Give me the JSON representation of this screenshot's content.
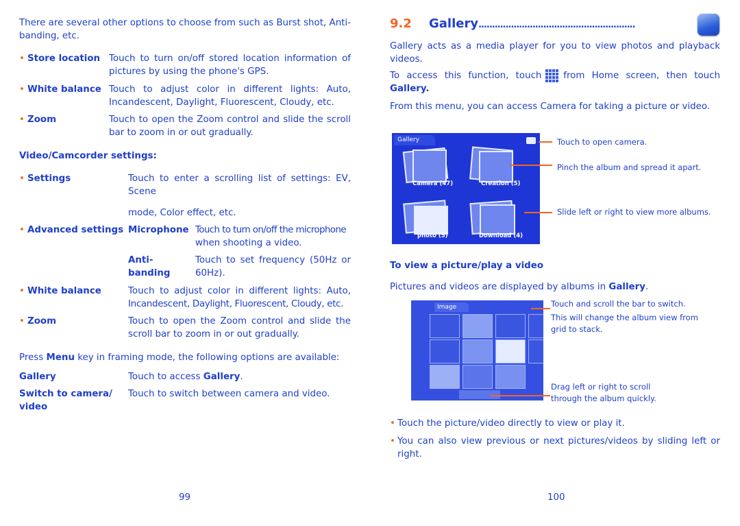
{
  "left_page": {
    "intro": [
      "There are several other options to choose from such as Burst shot, Anti-",
      "banding, etc."
    ],
    "photo_settings": [
      {
        "term": "Store location",
        "desc": [
          "Touch to turn on/off stored location information of",
          "pictures by using the phone's GPS."
        ]
      },
      {
        "term": "White balance",
        "desc": [
          "Touch to adjust color in different lights: Auto,",
          "Incandescent, Daylight, Fluorescent, Cloudy, etc."
        ]
      },
      {
        "term": "Zoom",
        "desc": [
          "Touch to open the Zoom control and slide the scroll",
          "bar to zoom in or out gradually."
        ]
      }
    ],
    "video_heading": "Video/Camcorder settings:",
    "settings": {
      "term": "Settings",
      "desc": [
        "Touch to enter a scrolling list of settings: EV,",
        "Scene",
        "mode, Color effect, etc."
      ]
    },
    "advanced": {
      "term": "Advanced settings",
      "items": [
        {
          "term": "Microphone",
          "desc": [
            "Touch to turn on/off the microphone",
            "when shooting a video."
          ]
        },
        {
          "term": [
            "Anti-",
            "banding"
          ],
          "desc": [
            "Touch to set frequency (50Hz or",
            "60Hz)."
          ]
        }
      ]
    },
    "video_settings": [
      {
        "term": "White balance",
        "desc": [
          "Touch to adjust color in different lights: Auto,",
          "Incandescent, Daylight, Fluorescent, Cloudy, etc."
        ]
      },
      {
        "term": "Zoom",
        "desc": [
          "Touch to open the Zoom control and slide the",
          "scroll bar to zoom in or out gradually."
        ]
      }
    ],
    "menu_note": {
      "pre": "Press ",
      "key": "Menu",
      "post": " key in framing mode, the following options are available:"
    },
    "menu_options": [
      {
        "term": "Gallery",
        "desc_pre": "Touch to access ",
        "desc_bold": "Gallery",
        "desc_post": "."
      },
      {
        "term": [
          "Switch to camera/",
          "video"
        ],
        "desc": "Touch to switch between camera and video."
      }
    ],
    "page_number": "99"
  },
  "right_page": {
    "section_number": "9.2",
    "section_title": "Gallery",
    "section_icon": "gallery-app-icon",
    "para1": [
      "Gallery acts as a media player for you to view photos and playback",
      "videos."
    ],
    "para2": {
      "pre": "To access this function, touch",
      "icon": "app-grid-icon",
      "post": "from Home screen, then touch",
      "bold": "Gallery."
    },
    "para3": "From this menu, you can access Camera for taking a picture or video.",
    "screenshot1": {
      "header": "Gallery",
      "albums": [
        "Camera (47)",
        "Creation (5)",
        "photo (5)",
        "Download (4)"
      ],
      "callouts": [
        "Touch to open camera.",
        "Pinch the album and spread it apart.",
        "Slide left or right to view more albums."
      ]
    },
    "subheading": "To view a picture/play a video",
    "para4": {
      "pre": "Pictures and videos are displayed by albums in ",
      "bold": "Gallery",
      "post": "."
    },
    "screenshot2": {
      "header": "Image",
      "callouts": [
        [
          "Touch and scroll the bar to switch.",
          "This will change the album view from",
          "grid to stack."
        ],
        [
          "Drag left or right to scroll",
          "through the album quickly."
        ]
      ]
    },
    "bullets": [
      [
        "Touch the picture/video directly to view or play it."
      ],
      [
        "You can also view previous or next pictures/videos by sliding left or",
        "right."
      ]
    ],
    "page_number": "100"
  },
  "colors": {
    "text": "#1f3fc8",
    "accent": "#f26522",
    "screen_blue": "#1f36d6"
  }
}
